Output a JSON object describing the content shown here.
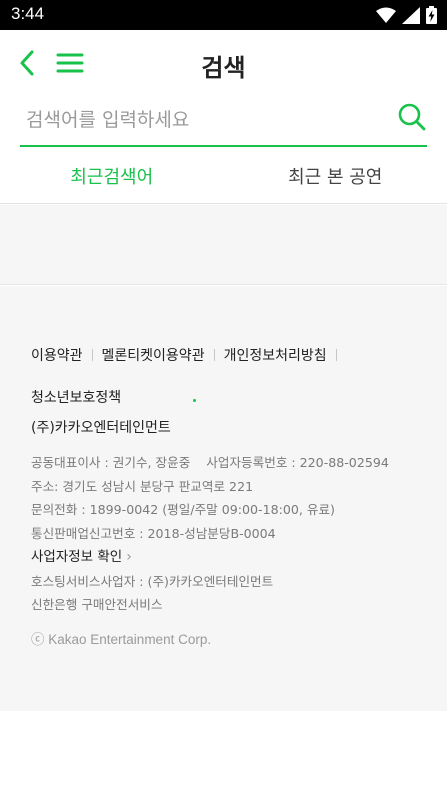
{
  "status_bar": {
    "time": "3:44",
    "icons": [
      "wifi-icon",
      "signal-icon",
      "battery-charging-icon"
    ]
  },
  "header": {
    "title": "검색",
    "back_icon": "chevron-left-icon",
    "menu_icon": "hamburger-menu-icon"
  },
  "search": {
    "value": "",
    "placeholder": "검색어를 입력하세요",
    "icon": "search-icon"
  },
  "tabs": [
    {
      "label": "최근검색어",
      "active": true
    },
    {
      "label": "최근 본 공연",
      "active": false
    }
  ],
  "footer": {
    "links": [
      "이용약관",
      "멜론티켓이용약관",
      "개인정보처리방침",
      "청소년보호정책"
    ],
    "company_name": "(주)카카오엔터테인먼트",
    "ceo": "공동대표이사 : 권기수, 장윤중",
    "business_reg": "사업자등록번호 : 220-88-02594",
    "address": "주소: 경기도 성남시 분당구 판교역로 221",
    "phone": "문의전화 : 1899-0042 (평일/주말 09:00-18:00, 유료)",
    "mail_order": "통신판매업신고번호 : 2018-성남분당B-0004",
    "business_info_link": "사업자정보 확인",
    "hosting": "호스팅서비스사업자 : (주)카카오엔터테인먼트",
    "escrow": "신한은행 구매안전서비스",
    "copyright": "ⓒ Kakao Entertainment Corp."
  },
  "colors": {
    "accent": "#18c24b",
    "footer_bg": "#f6f6f6",
    "status_bar_bg": "#000000"
  }
}
